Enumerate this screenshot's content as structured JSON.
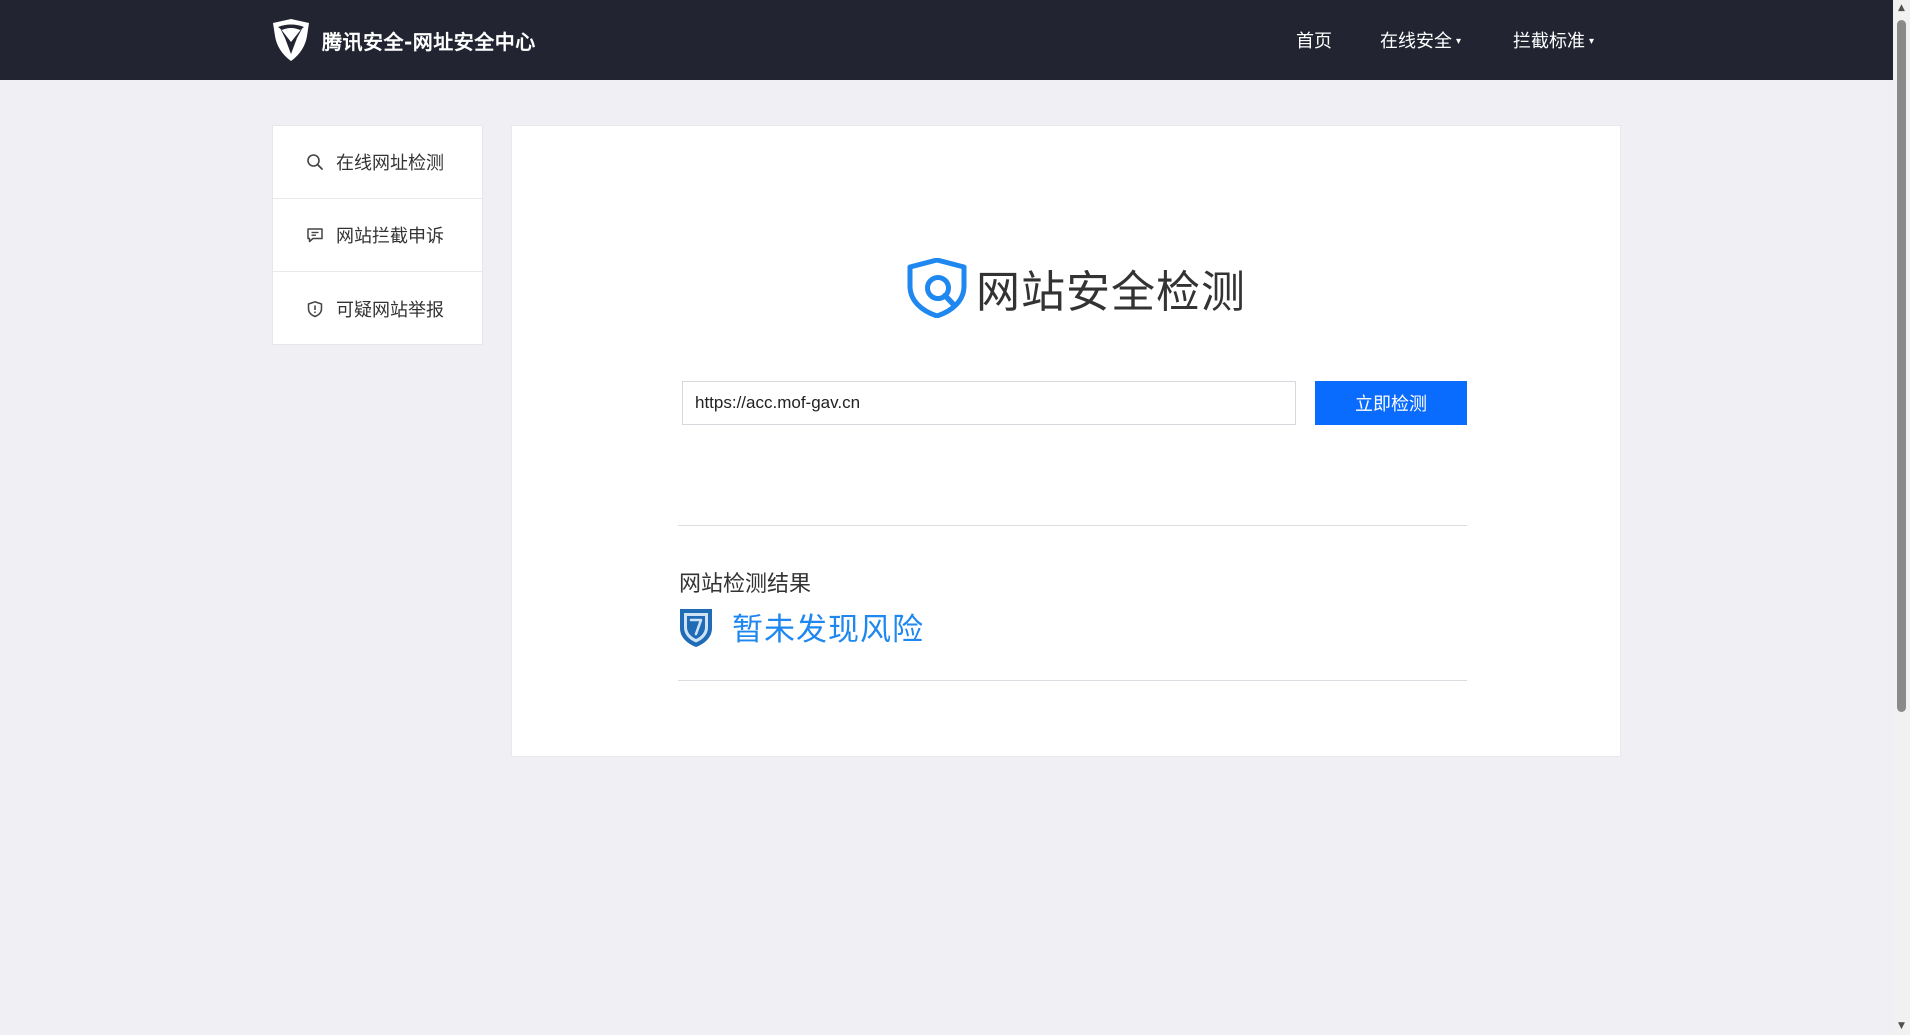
{
  "header": {
    "brand_title": "腾讯安全-网址安全中心",
    "nav": [
      {
        "label": "首页",
        "has_dropdown": false
      },
      {
        "label": "在线安全",
        "has_dropdown": true
      },
      {
        "label": "拦截标准",
        "has_dropdown": true
      }
    ],
    "caret": "▾"
  },
  "sidebar": {
    "items": [
      {
        "label": "在线网址检测",
        "icon": "search-icon"
      },
      {
        "label": "网站拦截申诉",
        "icon": "message-icon"
      },
      {
        "label": "可疑网站举报",
        "icon": "shield-icon"
      }
    ]
  },
  "main": {
    "hero_title": "网站安全检测",
    "url_value": "https://acc.mof-gav.cn",
    "check_button": "立即检测",
    "result_label": "网站检测结果",
    "result_text": "暂未发现风险"
  },
  "colors": {
    "header_bg": "#222531",
    "primary": "#0a6bff",
    "result": "#1e87f0"
  }
}
